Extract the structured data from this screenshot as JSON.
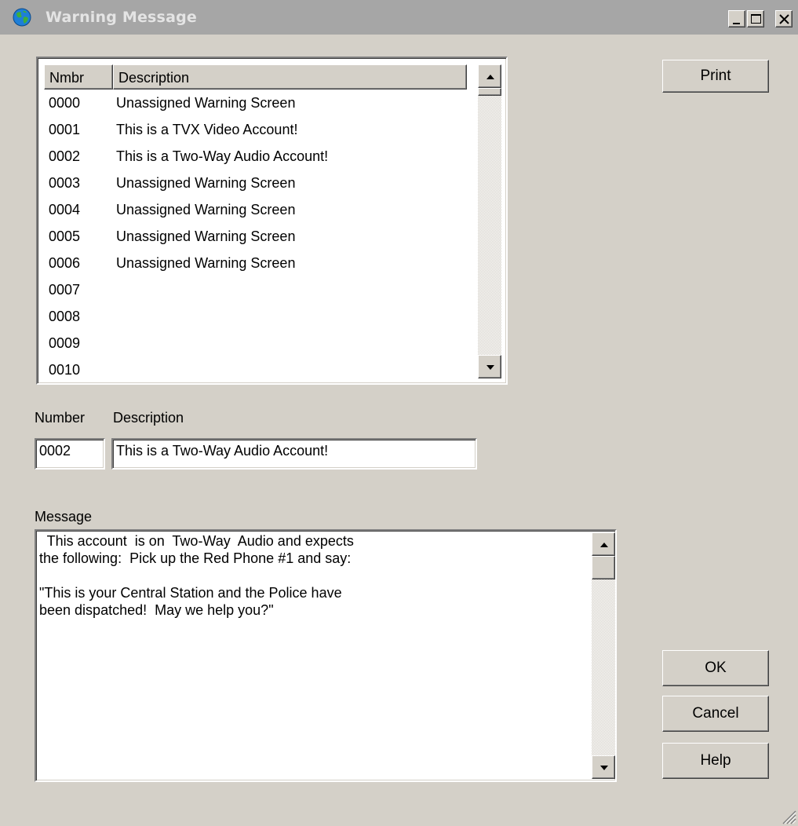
{
  "window": {
    "title": "Warning Message",
    "icon": "globe-icon",
    "controls": [
      "minimize-icon",
      "maximize-icon",
      "close-icon"
    ]
  },
  "list": {
    "columns": [
      "Nmbr",
      "Description"
    ],
    "rows": [
      {
        "number": "0000",
        "description": "Unassigned Warning Screen"
      },
      {
        "number": "0001",
        "description": "This is a TVX Video Account!"
      },
      {
        "number": "0002",
        "description": "This is a Two-Way Audio Account!"
      },
      {
        "number": "0003",
        "description": "Unassigned Warning Screen"
      },
      {
        "number": "0004",
        "description": "Unassigned Warning Screen"
      },
      {
        "number": "0005",
        "description": "Unassigned Warning Screen"
      },
      {
        "number": "0006",
        "description": "Unassigned Warning Screen"
      },
      {
        "number": "0007",
        "description": ""
      },
      {
        "number": "0008",
        "description": ""
      },
      {
        "number": "0009",
        "description": ""
      },
      {
        "number": "0010",
        "description": ""
      }
    ]
  },
  "form": {
    "number_label": "Number",
    "description_label": "Description",
    "number_value": "0002",
    "description_value": "This is a Two-Way Audio Account!",
    "message_label": "Message",
    "message_value": "  This account  is on  Two-Way  Audio and expects\nthe following:  Pick up the Red Phone #1 and say:\n\n\"This is your Central Station and the Police have\nbeen dispatched!  May we help you?\""
  },
  "buttons": {
    "print": "Print",
    "ok": "OK",
    "cancel": "Cancel",
    "help": "Help"
  },
  "colors": {
    "face": "#d4d0c8",
    "titlebar": "#a6a6a6",
    "title_text": "#e4e4e4"
  }
}
